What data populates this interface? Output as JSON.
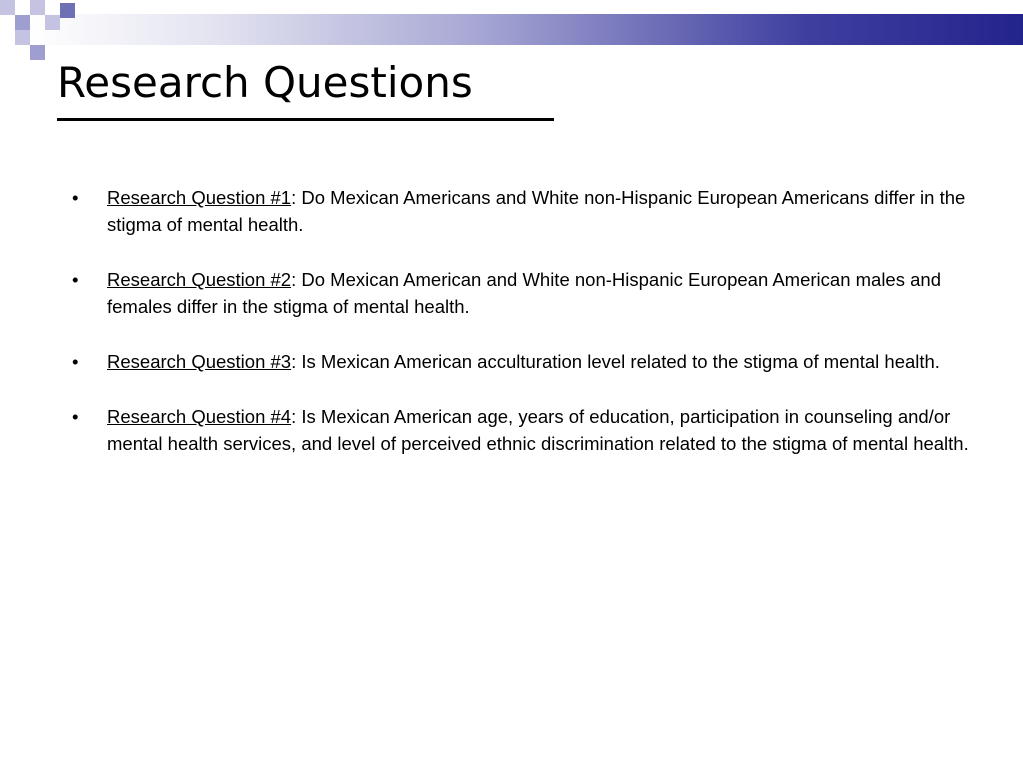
{
  "slide": {
    "title": "Research Questions",
    "items": [
      {
        "label": "Research Question #1",
        "text": ": Do Mexican Americans and White non-Hispanic European Americans differ in the stigma of mental health."
      },
      {
        "label": "Research Question #2",
        "text": ": Do Mexican American and White non-Hispanic European American males and females differ in the stigma of mental health."
      },
      {
        "label": "Research Question #3",
        "text": ": Is Mexican American acculturation level related to the stigma of mental health."
      },
      {
        "label": "Research Question #4",
        "text": ": Is Mexican American age, years of education, participation in counseling and/or mental health services, and level of perceived ethnic discrimination related to the stigma of mental health."
      }
    ],
    "bullet_char": "•",
    "colors": {
      "accent_dark": "#23238c",
      "accent_light": "#c4c4e2",
      "text": "#000000"
    }
  }
}
